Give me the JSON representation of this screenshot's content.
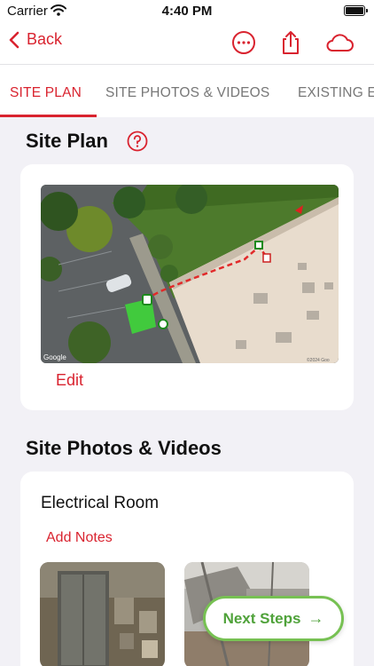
{
  "status": {
    "carrier": "Carrier",
    "time": "4:40 PM"
  },
  "nav": {
    "back_label": "Back",
    "icons": [
      "more-icon",
      "share-icon",
      "cloud-icon"
    ]
  },
  "tabs": [
    {
      "label": "SITE PLAN",
      "active": true
    },
    {
      "label": "SITE PHOTOS & VIDEOS",
      "active": false
    },
    {
      "label": "EXISTING E",
      "active": false
    }
  ],
  "site_plan": {
    "title": "Site Plan",
    "edit_label": "Edit",
    "map_attribution": "Google",
    "map_copyright": "©2024 Goo"
  },
  "site_photos": {
    "title": "Site Photos & Videos",
    "room": {
      "title": "Electrical Room",
      "add_notes_label": "Add Notes"
    }
  },
  "next_steps_label": "Next Steps",
  "colors": {
    "accent": "#d9232f",
    "green": "#77c153"
  }
}
